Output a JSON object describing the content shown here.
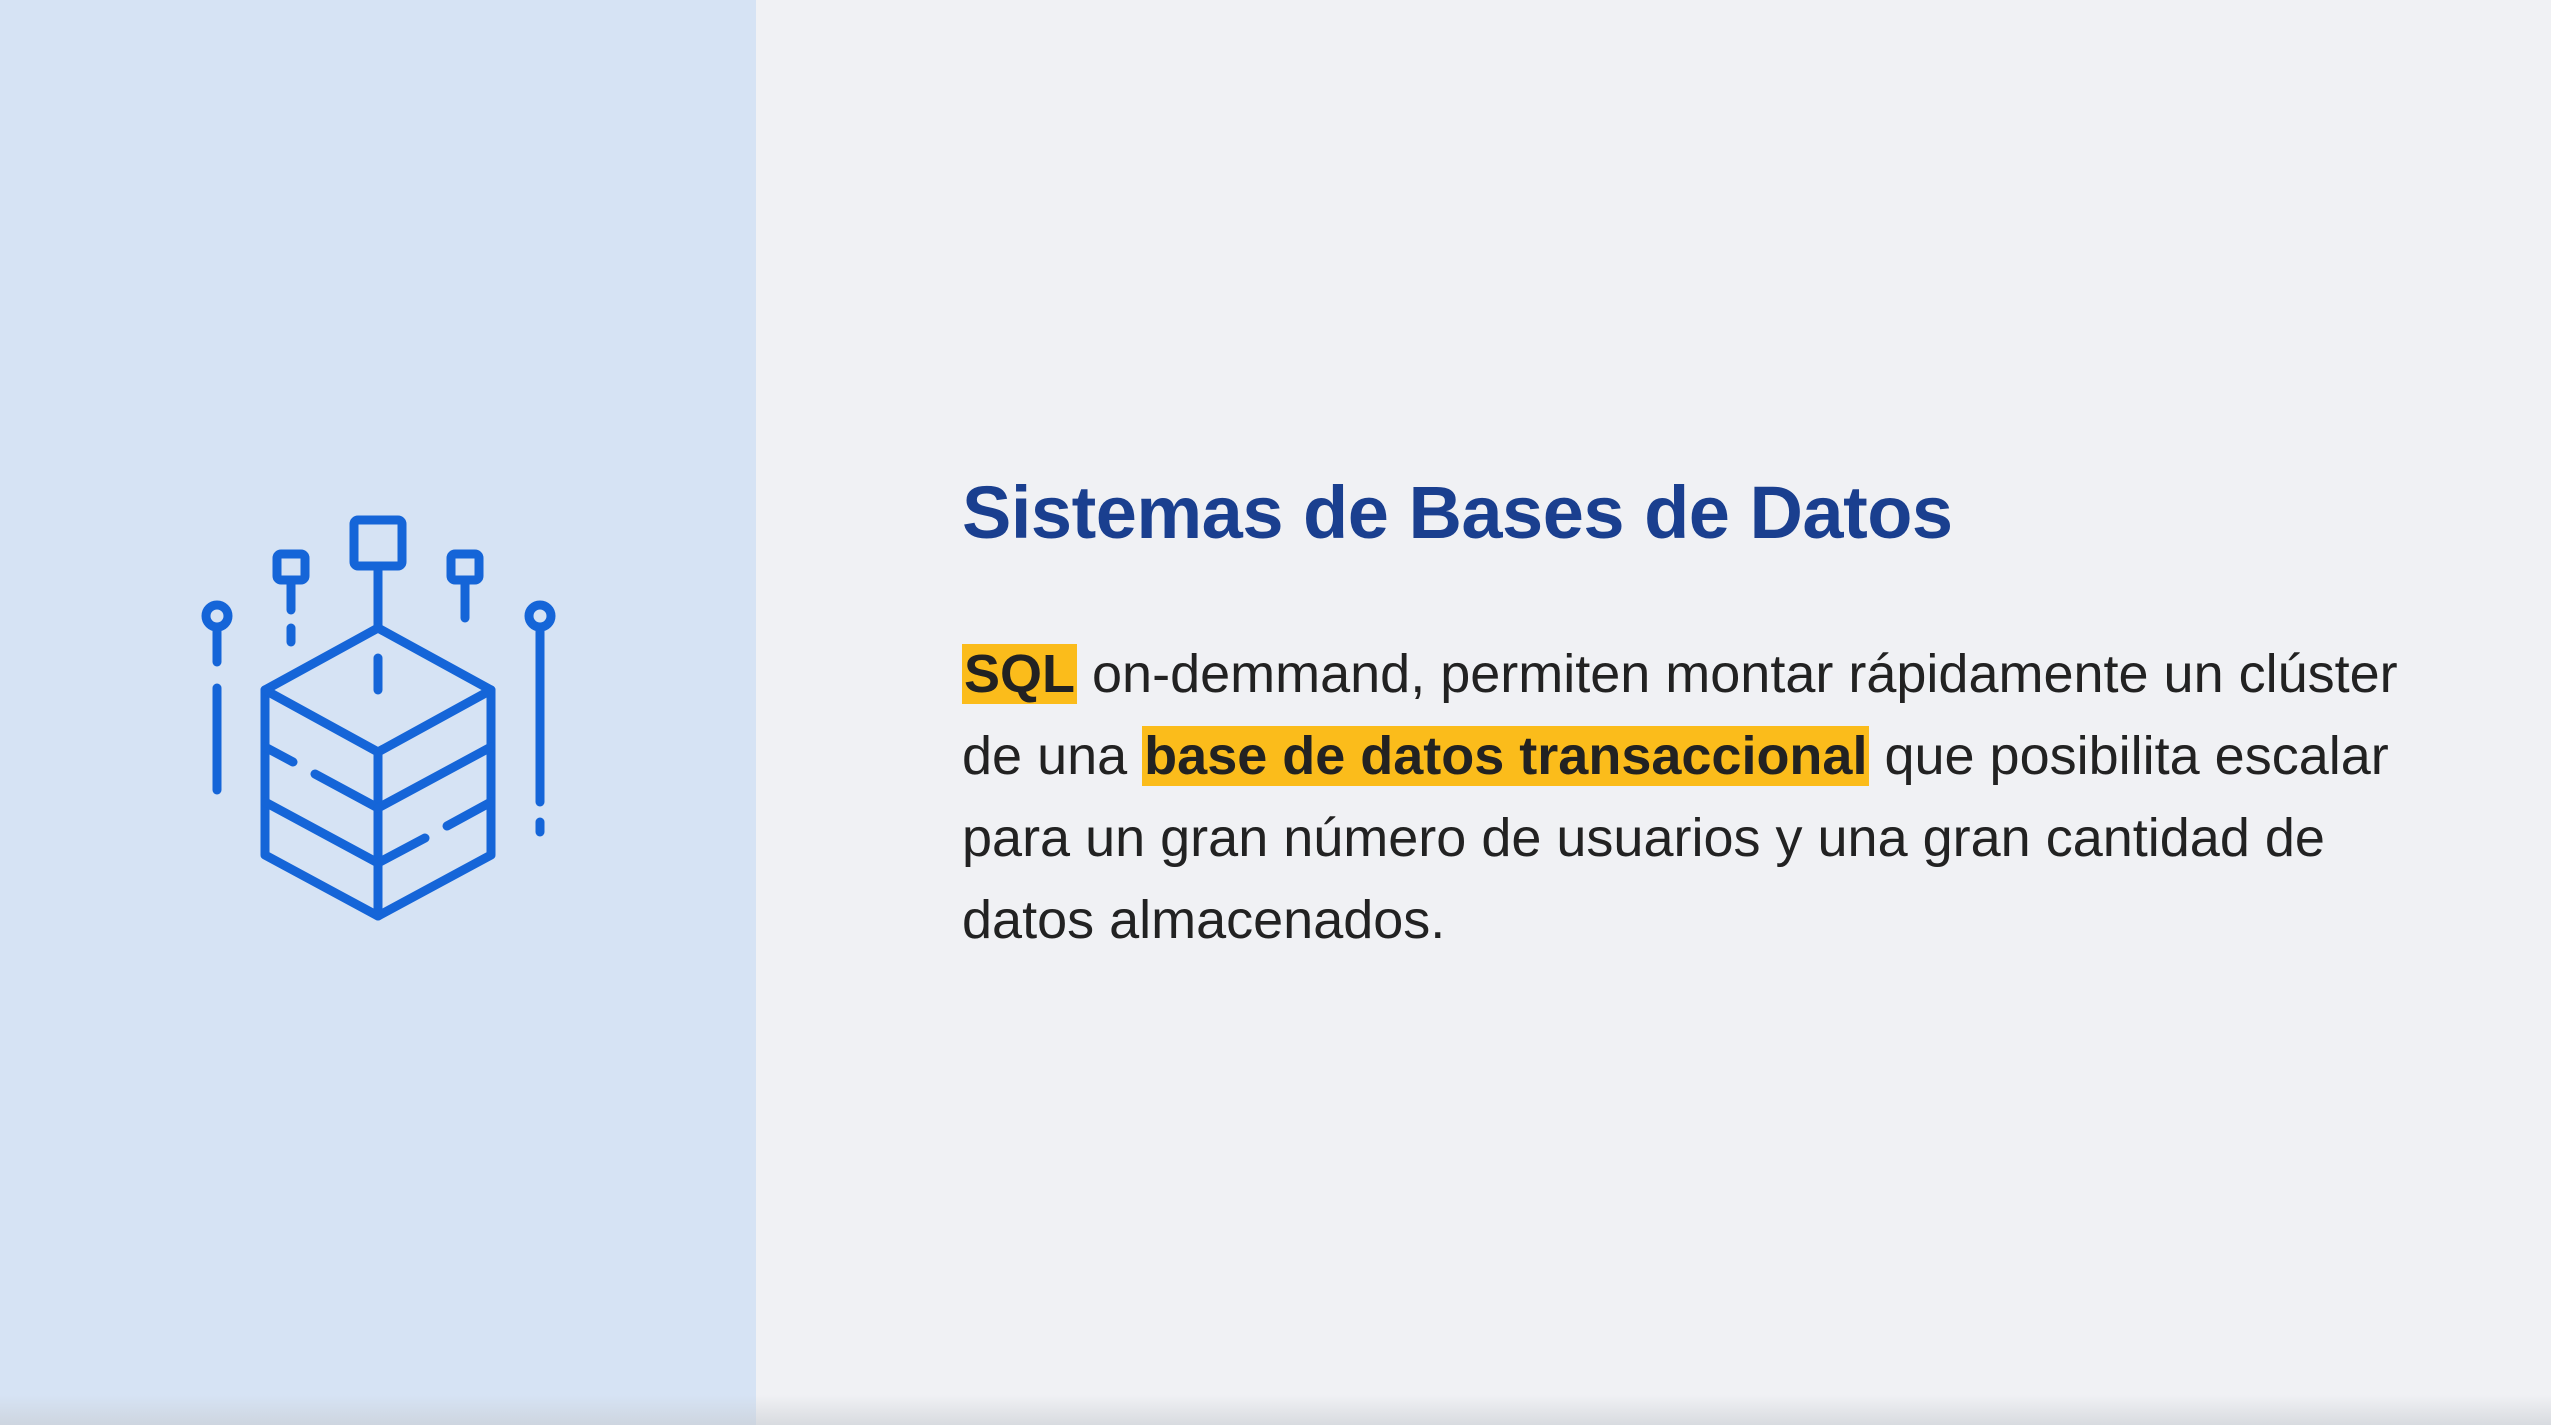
{
  "slide": {
    "title": "Sistemas de Bases de Datos",
    "paragraph": {
      "highlight_1": "SQL",
      "text_1": " on-demmand, permiten montar rápidamente un clúster de una ",
      "highlight_2": "base de datos transaccional",
      "text_2": " que posibilita escalar para un gran número de usuarios y una gran cantidad de datos almacenados."
    },
    "illustration_icon": "database-cube-network-icon"
  },
  "colors": {
    "left_panel": "#d6e3f4",
    "background": "#f0f1f4",
    "title": "#1a3f8f",
    "icon": "#1565d8",
    "highlight": "#fbbc1b",
    "text": "#222222"
  }
}
